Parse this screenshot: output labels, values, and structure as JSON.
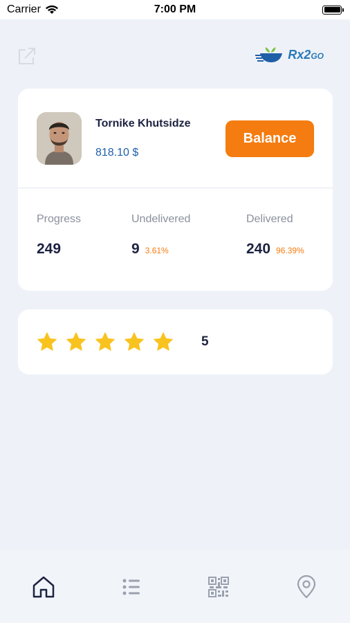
{
  "status_bar": {
    "carrier": "Carrier",
    "time": "7:00 PM"
  },
  "header": {
    "logo_main": "Rx2",
    "logo_suffix": "GO"
  },
  "profile": {
    "name": "Tornike Khutsidze",
    "balance": "818.10 $",
    "balance_button": "Balance"
  },
  "stats": [
    {
      "label": "Progress",
      "value": "249",
      "percent": ""
    },
    {
      "label": "Undelivered",
      "value": "9",
      "percent": "3.61%"
    },
    {
      "label": "Delivered",
      "value": "240",
      "percent": "96.39%"
    }
  ],
  "rating": {
    "value": "5",
    "stars": 5,
    "star_color": "#f9c31f"
  },
  "colors": {
    "accent": "#f57c10",
    "brand_blue": "#1f5fa8",
    "background": "#eef2f8"
  },
  "nav_icons": [
    "home-icon",
    "list-icon",
    "qr-code-icon",
    "location-pin-icon"
  ]
}
